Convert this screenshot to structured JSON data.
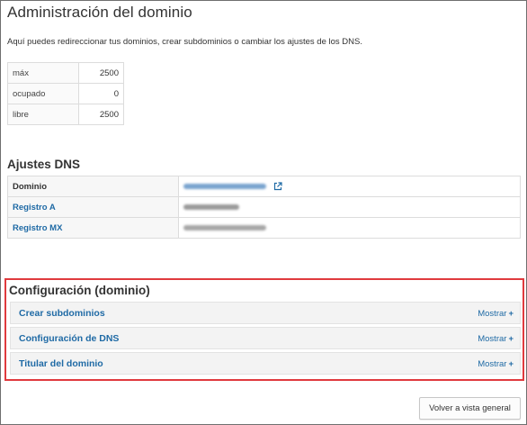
{
  "page": {
    "title": "Administración del dominio",
    "intro": "Aquí puedes redireccionar tus dominios, crear subdominios o cambiar los ajustes de los DNS."
  },
  "quota": [
    {
      "label": "máx",
      "value": "2500"
    },
    {
      "label": "ocupado",
      "value": "0"
    },
    {
      "label": "libre",
      "value": "2500"
    }
  ],
  "dns_settings": {
    "title": "Ajustes DNS",
    "rows": [
      {
        "label": "Dominio",
        "value_type": "redacted-link",
        "icon": "external-link-icon"
      },
      {
        "label": "Registro A",
        "value_type": "redacted-text"
      },
      {
        "label": "Registro MX",
        "value_type": "redacted-text"
      }
    ]
  },
  "config": {
    "title": "Configuración (dominio)",
    "toggle_label": "Mostrar",
    "toggle_icon": "plus-icon",
    "items": [
      {
        "label": "Crear subdominios"
      },
      {
        "label": "Configuración de DNS"
      },
      {
        "label": "Titular del dominio"
      }
    ]
  },
  "footer": {
    "back_label": "Volver a vista general"
  },
  "colors": {
    "link": "#1f6aa5",
    "highlight_border": "#e03a3e",
    "text": "#333333"
  }
}
